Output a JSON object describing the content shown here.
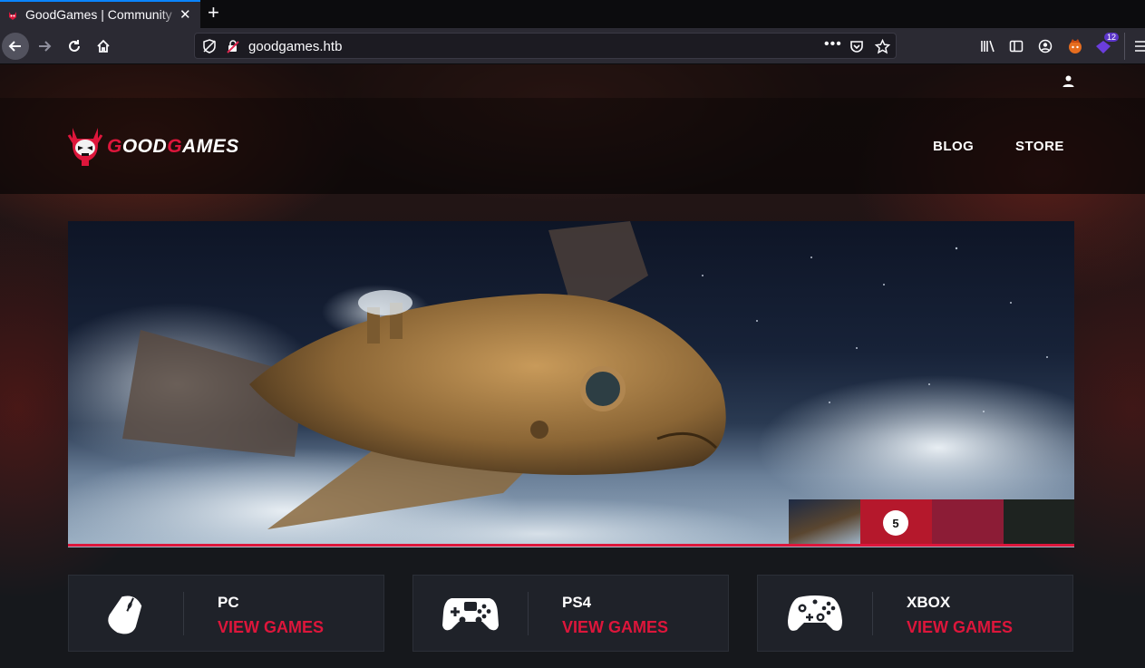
{
  "browser": {
    "tab_title": "GoodGames | Community",
    "url": "goodgames.htb",
    "extension_badge": "12",
    "accent": "#0a84ff"
  },
  "site": {
    "logo": {
      "prefix": "G",
      "middle": "OOD",
      "infix": "G",
      "suffix": "AMES"
    },
    "nav": [
      "BLOG",
      "STORE"
    ],
    "accent": "#dd163b",
    "slider": {
      "active_thumb_count": "5"
    },
    "categories": [
      {
        "name": "PC",
        "action": "VIEW GAMES",
        "icon": "mouse-icon"
      },
      {
        "name": "PS4",
        "action": "VIEW GAMES",
        "icon": "gamepad-icon"
      },
      {
        "name": "XBOX",
        "action": "VIEW GAMES",
        "icon": "xbox-controller-icon"
      }
    ]
  }
}
